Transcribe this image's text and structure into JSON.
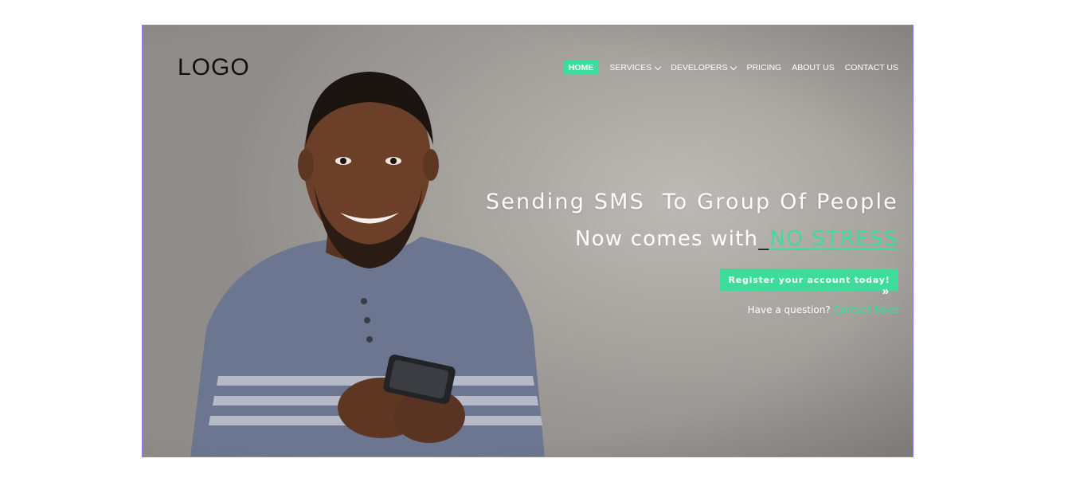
{
  "brand": {
    "logo_text": "LOGO"
  },
  "nav": {
    "items": [
      {
        "label": "HOME",
        "active": true,
        "dropdown": false
      },
      {
        "label": "SERVICES",
        "active": false,
        "dropdown": true
      },
      {
        "label": "DEVELOPERS",
        "active": false,
        "dropdown": true
      },
      {
        "label": "PRICING",
        "active": false,
        "dropdown": false
      },
      {
        "label": "ABOUT US",
        "active": false,
        "dropdown": false
      },
      {
        "label": "CONTACT US",
        "active": false,
        "dropdown": false
      }
    ]
  },
  "hero": {
    "headline": "Sending SMS  To Group Of People",
    "subline_prefix": "Now comes with",
    "subline_underscore": "_",
    "subline_highlight": "NO STRESS",
    "cta_label": "Register your account today!",
    "cta_arrow": "»",
    "question_text": "Have a question?",
    "contact_link": "Contact Sales"
  },
  "colors": {
    "accent": "#3ddc9b",
    "text_light": "#ffffff",
    "logo_text": "#111111",
    "frame_border": "#8a7df0"
  },
  "icons": {
    "dropdown": "chevron-down-icon",
    "cta": "double-chevron-right-icon"
  }
}
